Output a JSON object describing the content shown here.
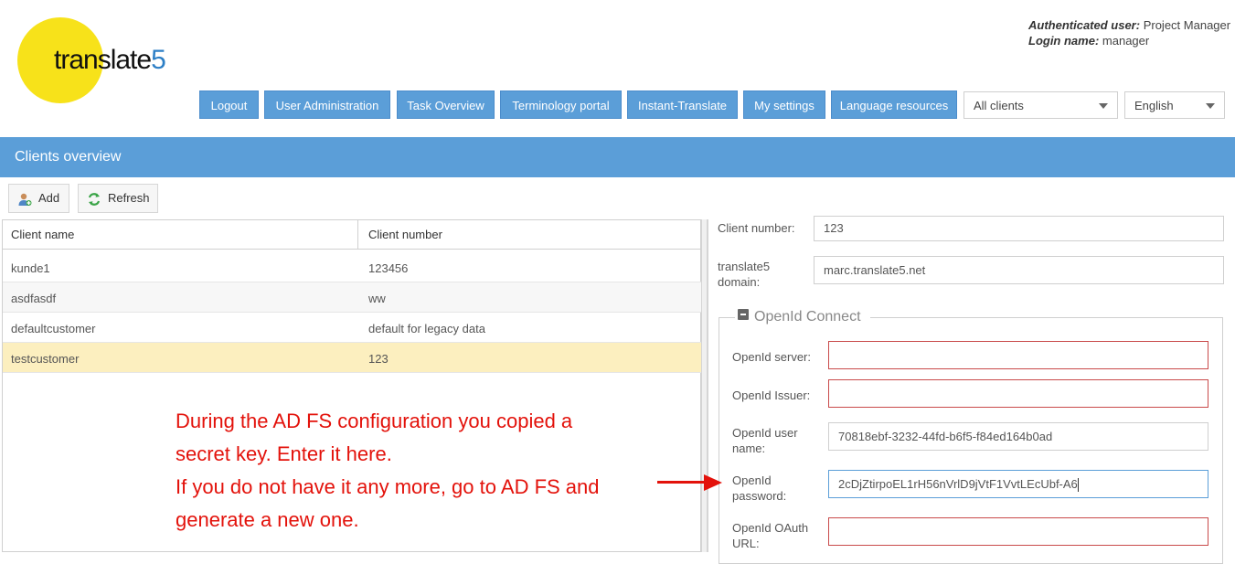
{
  "header": {
    "logo_text": "translate",
    "logo_digit": "5",
    "auth_user_label": "Authenticated user:",
    "auth_user_value": "Project Manager",
    "login_label": "Login name:",
    "login_value": "manager"
  },
  "nav": {
    "logout": "Logout",
    "user_admin": "User Administration",
    "task_overview": "Task Overview",
    "terminology": "Terminology portal",
    "instant_translate": "Instant-Translate",
    "my_settings": "My settings",
    "language_resources": "Language resources",
    "client_select": "All clients",
    "language_select": "English"
  },
  "panel": {
    "title": "Clients overview",
    "add": "Add",
    "refresh": "Refresh"
  },
  "grid": {
    "columns": [
      "Client name",
      "Client number"
    ],
    "rows": [
      {
        "name": "kunde1",
        "number": "123456"
      },
      {
        "name": "asdfasdf",
        "number": "ww"
      },
      {
        "name": "defaultcustomer",
        "number": "default for legacy data"
      },
      {
        "name": "testcustomer",
        "number": "123"
      }
    ]
  },
  "form": {
    "client_number_label": "Client number:",
    "client_number_value": "123",
    "domain_label_1": "translate5",
    "domain_label_2": "domain:",
    "domain_value": "marc.translate5.net",
    "openid_legend": "OpenId Connect",
    "server_label": "OpenId server:",
    "server_value": "",
    "issuer_label": "OpenId Issuer:",
    "issuer_value": "",
    "user_label_1": "OpenId user",
    "user_label_2": "name:",
    "user_value": "70818ebf-3232-44fd-b6f5-f84ed164b0ad",
    "password_label_1": "OpenId",
    "password_label_2": "password:",
    "password_value": "2cDjZtirpoEL1rH56nVrlD9jVtF1VvtLEcUbf-A6",
    "oauth_label_1": "OpenId OAuth",
    "oauth_label_2": "URL:",
    "oauth_value": ""
  },
  "annotation": {
    "line1": "During the AD FS configuration you copied a",
    "line2": "secret key. Enter it here.",
    "line3": "If you do not have it any more, go to AD FS and",
    "line4": "generate a new one."
  },
  "colors": {
    "accent": "#5b9ed8",
    "logo_yellow": "#f7e21a",
    "selected_row": "#fcefbf",
    "error_border": "#c94a4a",
    "annotation_red": "#e3120b"
  }
}
